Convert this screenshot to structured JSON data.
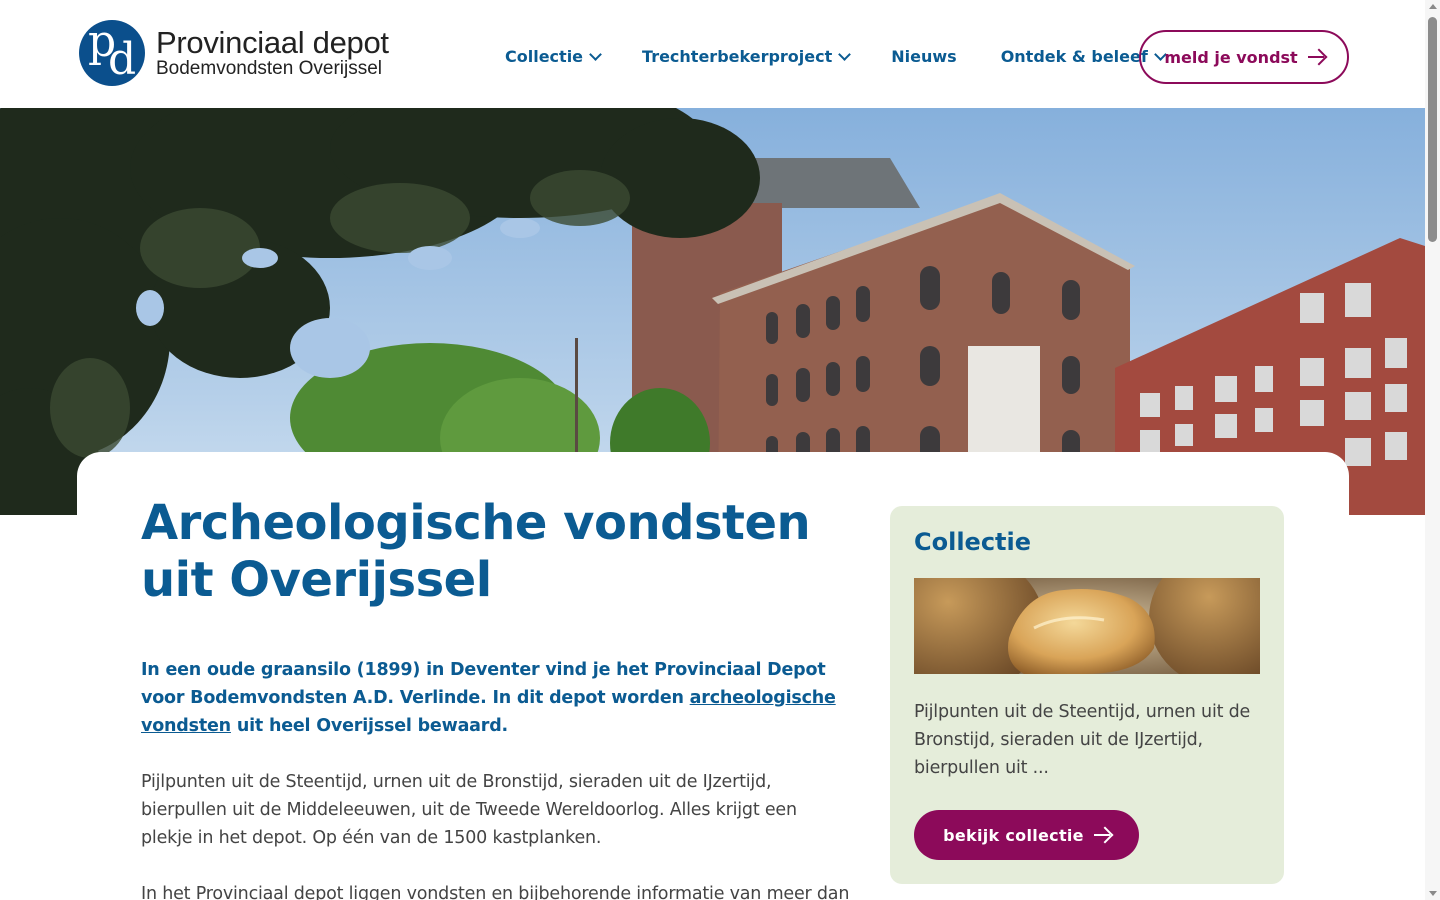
{
  "header": {
    "logo": {
      "mark_letters": [
        "p",
        "d"
      ],
      "title": "Provinciaal depot",
      "subtitle": "Bodemvondsten Overijssel"
    },
    "nav": [
      {
        "label": "Collectie",
        "has_dropdown": true,
        "icon": "chevron-down-icon"
      },
      {
        "label": "Trechterbekerproject",
        "has_dropdown": true,
        "icon": "chevron-down-icon"
      },
      {
        "label": "Nieuws",
        "has_dropdown": false
      },
      {
        "label": "Ontdek & beleef",
        "has_dropdown": true,
        "icon": "chevron-down-icon"
      }
    ],
    "cta": {
      "label": "meld je vondst",
      "icon": "arrow-right-icon"
    }
  },
  "hero": {
    "image": "grain-silo-building-photo"
  },
  "main": {
    "title": "Archeologische vondsten uit Overijssel",
    "intro_before": "In een oude graansilo (1899) in Deventer vind je het Provinciaal Depot voor Bodemvondsten A.D. Verlinde. In dit depot worden ",
    "intro_link": "archeologische vondsten",
    "intro_after": " uit heel Overijssel bewaard.",
    "paragraph1": "Pijlpunten uit de Steentijd, urnen uit de Bronstijd, sieraden uit de IJzertijd, bierpullen uit de Middeleeuwen, uit de Tweede Wereldoorlog. Alles krijgt een plekje in het depot. Op één van de 1500 kastplanken.",
    "paragraph2": "In het Provinciaal depot liggen vondsten en bijbehorende informatie van meer dan"
  },
  "sidebar": {
    "title": "Collectie",
    "image": "pottery-fragments-photo",
    "text": "Pijlpunten uit de Steentijd, urnen uit de Bronstijd, sieraden uit de IJzertijd, bierpullen uit ...",
    "button": {
      "label": "bekijk collectie",
      "icon": "arrow-right-icon"
    }
  },
  "colors": {
    "primary_blue": "#0b5b92",
    "accent_purple": "#8c0a5a",
    "sidebar_bg": "#e5edda"
  }
}
